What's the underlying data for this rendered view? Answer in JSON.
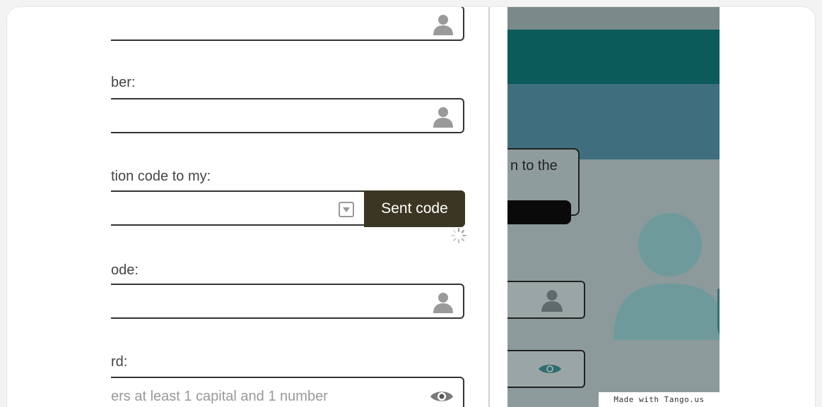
{
  "form": {
    "label_phone": "ber:",
    "label_send_code": "tion code to my:",
    "label_code": "ode:",
    "label_password": "rd:",
    "password_placeholder": "ers at least 1 capital and 1 number",
    "send_button": "Sent code"
  },
  "preview": {
    "dialog_text": "n to the"
  },
  "watermark": "Made with Tango.us",
  "colors": {
    "send_button_bg": "#3b3623",
    "header_teal": "#0b5b5b"
  }
}
